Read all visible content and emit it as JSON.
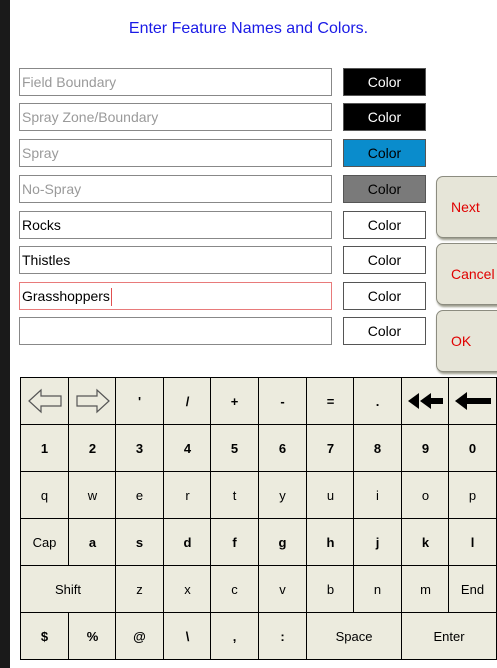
{
  "title": "Enter Feature Names and Colors.",
  "features": [
    {
      "name": "",
      "placeholder": "Field Boundary",
      "color_label": "Color",
      "color": "#000000",
      "text_color": "#ffffff"
    },
    {
      "name": "",
      "placeholder": "Spray Zone/Boundary",
      "color_label": "Color",
      "color": "#000000",
      "text_color": "#ffffff"
    },
    {
      "name": "",
      "placeholder": "Spray",
      "color_label": "Color",
      "color": "#0a8ccc",
      "text_color": "#000000"
    },
    {
      "name": "",
      "placeholder": "No-Spray",
      "color_label": "Color",
      "color": "#7a7a7a",
      "text_color": "#000000"
    },
    {
      "name": "Rocks",
      "placeholder": "",
      "color_label": "Color",
      "color": "#ffffff",
      "text_color": "#000000"
    },
    {
      "name": "Thistles",
      "placeholder": "",
      "color_label": "Color",
      "color": "#ffffff",
      "text_color": "#000000"
    },
    {
      "name": "Grasshoppers",
      "placeholder": "",
      "color_label": "Color",
      "color": "#ffffff",
      "text_color": "#000000"
    },
    {
      "name": "",
      "placeholder": "",
      "color_label": "Color",
      "color": "#ffffff",
      "text_color": "#000000"
    }
  ],
  "buttons": {
    "next": "Next",
    "cancel": "Cancel",
    "ok": "OK"
  },
  "keyboard": {
    "row1": [
      "'",
      "/",
      "+",
      "-",
      "=",
      "."
    ],
    "row2": [
      "1",
      "2",
      "3",
      "4",
      "5",
      "6",
      "7",
      "8",
      "9",
      "0"
    ],
    "row3": [
      "q",
      "w",
      "e",
      "r",
      "t",
      "y",
      "u",
      "i",
      "o",
      "p"
    ],
    "row4": [
      "Cap",
      "a",
      "s",
      "d",
      "f",
      "g",
      "h",
      "j",
      "k",
      "l"
    ],
    "row5": [
      "Shift",
      "z",
      "x",
      "c",
      "v",
      "b",
      "n",
      "m",
      "End"
    ],
    "row6": [
      "$",
      "%",
      "@",
      "\\",
      ",",
      ":",
      "Space",
      "Enter"
    ]
  },
  "icons": {
    "left": "left-arrow-icon",
    "right": "right-arrow-icon",
    "double_back": "double-backspace-icon",
    "back": "backspace-icon"
  },
  "colors": {
    "title": "#1a1ae6",
    "button_text": "#e00000",
    "active_field_border": "#e87a7a"
  }
}
